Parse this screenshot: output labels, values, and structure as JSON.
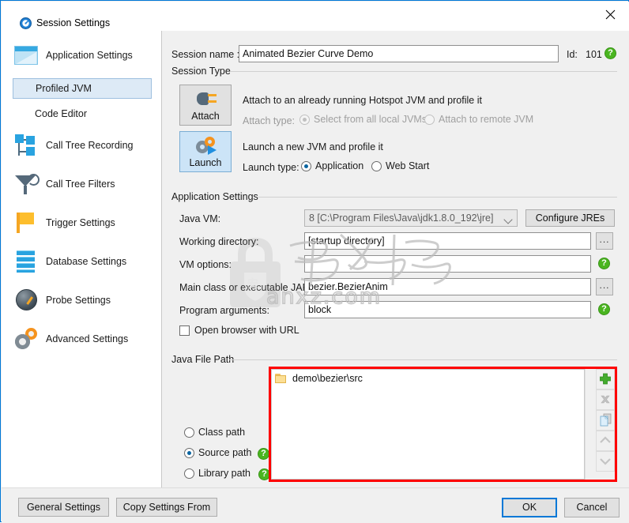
{
  "window": {
    "title": "Session Settings",
    "title_icon": "profiler-circle-icon",
    "close_icon": "close-icon"
  },
  "sidebar": {
    "items": [
      {
        "label": "Application Settings",
        "icon": "application-window-icon",
        "type": "group",
        "selected": false
      },
      {
        "label": "Profiled JVM",
        "icon": "",
        "type": "sub",
        "selected": true
      },
      {
        "label": "Code Editor",
        "icon": "",
        "type": "sub",
        "selected": false
      },
      {
        "label": "Call Tree Recording",
        "icon": "call-tree-icon",
        "type": "group",
        "selected": false
      },
      {
        "label": "Call Tree Filters",
        "icon": "funnel-icon",
        "type": "group",
        "selected": false
      },
      {
        "label": "Trigger Settings",
        "icon": "flag-icon",
        "type": "group",
        "selected": false
      },
      {
        "label": "Database Settings",
        "icon": "database-icon",
        "type": "group",
        "selected": false
      },
      {
        "label": "Probe Settings",
        "icon": "gauge-icon",
        "type": "group",
        "selected": false
      },
      {
        "label": "Advanced Settings",
        "icon": "gears-icon",
        "type": "group",
        "selected": false
      }
    ]
  },
  "session": {
    "name_label": "Session name :",
    "name_value": "Animated Bezier Curve Demo",
    "id_label": "Id:",
    "id_value": "101",
    "help_icon": "help-icon"
  },
  "session_type": {
    "group_title": "Session Type",
    "attach": {
      "button_label": "Attach",
      "icon": "plug-icon",
      "selected": false,
      "description": "Attach to an already running Hotspot JVM and profile it",
      "type_label": "Attach type:",
      "options": [
        {
          "label": "Select from all local JVMs",
          "selected": true,
          "disabled": true
        },
        {
          "label": "Attach to remote JVM",
          "selected": false,
          "disabled": true
        }
      ]
    },
    "launch": {
      "button_label": "Launch",
      "icon": "launch-gear-icon",
      "selected": true,
      "description": "Launch a new JVM and profile it",
      "type_label": "Launch type:",
      "options": [
        {
          "label": "Application",
          "selected": true,
          "disabled": false
        },
        {
          "label": "Web Start",
          "selected": false,
          "disabled": false
        }
      ]
    }
  },
  "application_settings": {
    "group_title": "Application Settings",
    "java_vm_label": "Java VM:",
    "java_vm_value": "8 [C:\\Program Files\\Java\\jdk1.8.0_192\\jre]",
    "configure_jres_label": "Configure JREs",
    "working_dir_label": "Working directory:",
    "working_dir_value": "[startup directory]",
    "vm_options_label": "VM options:",
    "vm_options_value": "",
    "main_class_label": "Main class or executable JAR:",
    "main_class_value": "bezier.BezierAnim",
    "program_args_label": "Program arguments:",
    "program_args_value": "block",
    "open_browser_label": "Open browser with URL",
    "open_browser_checked": false,
    "browse_label": "...",
    "help_icon": "help-icon"
  },
  "java_file_path": {
    "group_title": "Java File Path",
    "options": [
      {
        "label": "Class path",
        "selected": false,
        "has_help": false
      },
      {
        "label": "Source path",
        "selected": true,
        "has_help": true
      },
      {
        "label": "Library path",
        "selected": false,
        "has_help": true
      }
    ],
    "entries": [
      {
        "label": "demo\\bezier\\src",
        "icon": "folder-icon"
      }
    ],
    "tools": [
      {
        "name": "add-path-button",
        "icon": "plus-icon",
        "enabled": true
      },
      {
        "name": "remove-path-button",
        "icon": "x-icon",
        "enabled": false
      },
      {
        "name": "copy-path-button",
        "icon": "copy-file-icon",
        "enabled": true
      },
      {
        "name": "move-up-button",
        "icon": "chevron-up-icon",
        "enabled": false
      },
      {
        "name": "move-down-button",
        "icon": "chevron-down-icon",
        "enabled": false
      }
    ]
  },
  "footer": {
    "general_settings_label": "General Settings",
    "copy_settings_label": "Copy Settings From",
    "ok_label": "OK",
    "cancel_label": "Cancel"
  },
  "watermark": {
    "text_cn": "安下载",
    "text_en": "anxz.com",
    "badge_char": "安"
  },
  "colors": {
    "accent": "#0078d7",
    "selection": "#cce4f7",
    "help_green": "#4ab520",
    "highlight_red": "#ff0000"
  }
}
